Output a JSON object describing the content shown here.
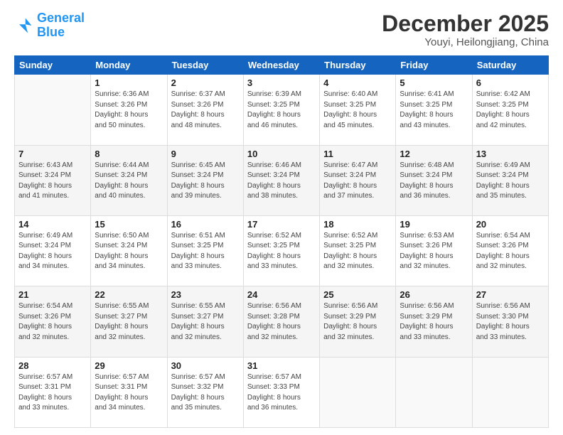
{
  "logo": {
    "line1": "General",
    "line2": "Blue"
  },
  "title": "December 2025",
  "subtitle": "Youyi, Heilongjiang, China",
  "headers": [
    "Sunday",
    "Monday",
    "Tuesday",
    "Wednesday",
    "Thursday",
    "Friday",
    "Saturday"
  ],
  "weeks": [
    [
      {
        "num": "",
        "detail": ""
      },
      {
        "num": "1",
        "detail": "Sunrise: 6:36 AM\nSunset: 3:26 PM\nDaylight: 8 hours\nand 50 minutes."
      },
      {
        "num": "2",
        "detail": "Sunrise: 6:37 AM\nSunset: 3:26 PM\nDaylight: 8 hours\nand 48 minutes."
      },
      {
        "num": "3",
        "detail": "Sunrise: 6:39 AM\nSunset: 3:25 PM\nDaylight: 8 hours\nand 46 minutes."
      },
      {
        "num": "4",
        "detail": "Sunrise: 6:40 AM\nSunset: 3:25 PM\nDaylight: 8 hours\nand 45 minutes."
      },
      {
        "num": "5",
        "detail": "Sunrise: 6:41 AM\nSunset: 3:25 PM\nDaylight: 8 hours\nand 43 minutes."
      },
      {
        "num": "6",
        "detail": "Sunrise: 6:42 AM\nSunset: 3:25 PM\nDaylight: 8 hours\nand 42 minutes."
      }
    ],
    [
      {
        "num": "7",
        "detail": "Sunrise: 6:43 AM\nSunset: 3:24 PM\nDaylight: 8 hours\nand 41 minutes."
      },
      {
        "num": "8",
        "detail": "Sunrise: 6:44 AM\nSunset: 3:24 PM\nDaylight: 8 hours\nand 40 minutes."
      },
      {
        "num": "9",
        "detail": "Sunrise: 6:45 AM\nSunset: 3:24 PM\nDaylight: 8 hours\nand 39 minutes."
      },
      {
        "num": "10",
        "detail": "Sunrise: 6:46 AM\nSunset: 3:24 PM\nDaylight: 8 hours\nand 38 minutes."
      },
      {
        "num": "11",
        "detail": "Sunrise: 6:47 AM\nSunset: 3:24 PM\nDaylight: 8 hours\nand 37 minutes."
      },
      {
        "num": "12",
        "detail": "Sunrise: 6:48 AM\nSunset: 3:24 PM\nDaylight: 8 hours\nand 36 minutes."
      },
      {
        "num": "13",
        "detail": "Sunrise: 6:49 AM\nSunset: 3:24 PM\nDaylight: 8 hours\nand 35 minutes."
      }
    ],
    [
      {
        "num": "14",
        "detail": "Sunrise: 6:49 AM\nSunset: 3:24 PM\nDaylight: 8 hours\nand 34 minutes."
      },
      {
        "num": "15",
        "detail": "Sunrise: 6:50 AM\nSunset: 3:24 PM\nDaylight: 8 hours\nand 34 minutes."
      },
      {
        "num": "16",
        "detail": "Sunrise: 6:51 AM\nSunset: 3:25 PM\nDaylight: 8 hours\nand 33 minutes."
      },
      {
        "num": "17",
        "detail": "Sunrise: 6:52 AM\nSunset: 3:25 PM\nDaylight: 8 hours\nand 33 minutes."
      },
      {
        "num": "18",
        "detail": "Sunrise: 6:52 AM\nSunset: 3:25 PM\nDaylight: 8 hours\nand 32 minutes."
      },
      {
        "num": "19",
        "detail": "Sunrise: 6:53 AM\nSunset: 3:26 PM\nDaylight: 8 hours\nand 32 minutes."
      },
      {
        "num": "20",
        "detail": "Sunrise: 6:54 AM\nSunset: 3:26 PM\nDaylight: 8 hours\nand 32 minutes."
      }
    ],
    [
      {
        "num": "21",
        "detail": "Sunrise: 6:54 AM\nSunset: 3:26 PM\nDaylight: 8 hours\nand 32 minutes."
      },
      {
        "num": "22",
        "detail": "Sunrise: 6:55 AM\nSunset: 3:27 PM\nDaylight: 8 hours\nand 32 minutes."
      },
      {
        "num": "23",
        "detail": "Sunrise: 6:55 AM\nSunset: 3:27 PM\nDaylight: 8 hours\nand 32 minutes."
      },
      {
        "num": "24",
        "detail": "Sunrise: 6:56 AM\nSunset: 3:28 PM\nDaylight: 8 hours\nand 32 minutes."
      },
      {
        "num": "25",
        "detail": "Sunrise: 6:56 AM\nSunset: 3:29 PM\nDaylight: 8 hours\nand 32 minutes."
      },
      {
        "num": "26",
        "detail": "Sunrise: 6:56 AM\nSunset: 3:29 PM\nDaylight: 8 hours\nand 33 minutes."
      },
      {
        "num": "27",
        "detail": "Sunrise: 6:56 AM\nSunset: 3:30 PM\nDaylight: 8 hours\nand 33 minutes."
      }
    ],
    [
      {
        "num": "28",
        "detail": "Sunrise: 6:57 AM\nSunset: 3:31 PM\nDaylight: 8 hours\nand 33 minutes."
      },
      {
        "num": "29",
        "detail": "Sunrise: 6:57 AM\nSunset: 3:31 PM\nDaylight: 8 hours\nand 34 minutes."
      },
      {
        "num": "30",
        "detail": "Sunrise: 6:57 AM\nSunset: 3:32 PM\nDaylight: 8 hours\nand 35 minutes."
      },
      {
        "num": "31",
        "detail": "Sunrise: 6:57 AM\nSunset: 3:33 PM\nDaylight: 8 hours\nand 36 minutes."
      },
      {
        "num": "",
        "detail": ""
      },
      {
        "num": "",
        "detail": ""
      },
      {
        "num": "",
        "detail": ""
      }
    ]
  ]
}
